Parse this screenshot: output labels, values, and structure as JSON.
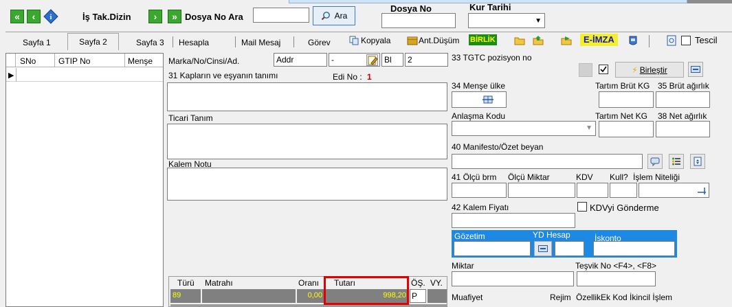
{
  "toolbar": {
    "is_takip": "İş Tak.Dizin",
    "dosya_no_ara": "Dosya No Ara",
    "ara_button": "Ara",
    "dosya_no_label": "Dosya No",
    "kur_tarihi_label": "Kur Tarihi"
  },
  "tabs": {
    "sayfa1": "Sayfa 1",
    "sayfa2": "Sayfa 2",
    "sayfa3": "Sayfa 3",
    "hesapla": "Hesapla",
    "mail_mesaj": "Mail Mesaj",
    "gorev": "Görev",
    "kopyala": "Kopyala",
    "ant_dusum": "Ant.Düşüm",
    "birlik": "BİRLİK",
    "e_imza": "E-İMZA",
    "tescil": "Tescil"
  },
  "grid": {
    "col_sno": "SNo",
    "col_gtip": "GTIP No",
    "col_mense": "Menşe"
  },
  "form": {
    "marka_label": "Marka/No/Cinsi/Ad.",
    "marka_value": "Addr",
    "marka_dash": "-",
    "marka_bl": "Bl",
    "marka_num": "2",
    "kaplar_label": "31 Kapların ve eşyanın tanımı",
    "edi_no_label": "Edi No :",
    "edi_no_value": "1",
    "ticari_tanim_label": "Ticari Tanım",
    "kalem_notu_label": "Kalem Notu"
  },
  "tax_table": {
    "col_turu": "Türü",
    "col_matrahi": "Matrahı",
    "col_orani": "Oranı",
    "col_tutari": "Tutarı",
    "col_os": "ÖŞ.",
    "col_vy": "VY.",
    "row_turu": "89",
    "row_orani": "0,00",
    "row_tutari": "998,20",
    "row_os": "P"
  },
  "right": {
    "tgtc_label": "33 TGTC pozisyon no",
    "birlestir": "Birleştir",
    "mense_ulke": "34 Menşe ülke",
    "tartim_brut": "Tartım Brüt KG",
    "brut_agirlik": "35 Brüt ağırlık",
    "anlasma_kodu": "Anlaşma Kodu",
    "tartim_net": "Tartım Net KG",
    "net_agirlik": "38 Net ağırlık",
    "manifesto": "40 Manifesto/Özet beyan",
    "olcu_brm": "41 Ölçü brm",
    "olcu_miktar": "Ölçü Miktar",
    "kdv": "KDV",
    "kull": "Kull?",
    "islem_niteligi": "İşlem Niteliği",
    "kalem_fiyati": "42 Kalem Fiyatı",
    "kdv_gonderme": "KDVyi Gönderme",
    "gozetim": "Gözetim",
    "yd_hesap": "YD Hesap",
    "iskonto": "İskonto",
    "miktar": "Miktar",
    "tesvik_no": "Teşvik No <F4>, <F8>",
    "muafiyet": "Muafiyet",
    "rejim": "Rejim",
    "ozellik": "ÖzellikEk Kod İkincil İşlem"
  },
  "colors": {
    "accent_blue": "#1e88e5",
    "tax_row_bg": "#808080",
    "tax_value": "#ffff00",
    "highlight_red": "#e00000"
  }
}
